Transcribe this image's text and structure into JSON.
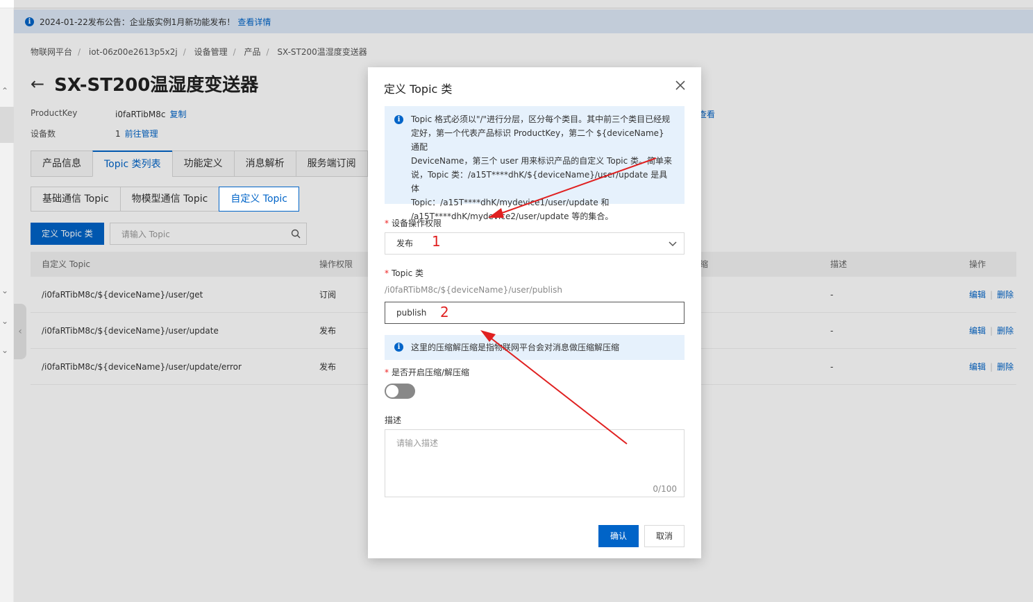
{
  "notice": {
    "text": "2024-01-22发布公告：企业版实例1月新功能发布！",
    "link": "查看详情"
  },
  "breadcrumb": [
    "物联网平台",
    "iot-06z00e2613p5x2j",
    "设备管理",
    "产品",
    "SX-ST200温湿度变送器"
  ],
  "page": {
    "title": "SX-ST200温湿度变送器",
    "productkey_label": "ProductKey",
    "productkey_value": "i0faRTibM8c",
    "copy_link": "复制",
    "devices_label": "设备数",
    "devices_value": "1",
    "manage_link": "前往管理",
    "right_link": "查看"
  },
  "tabs": [
    "产品信息",
    "Topic 类列表",
    "功能定义",
    "消息解析",
    "服务端订阅"
  ],
  "subtabs": [
    "基础通信 Topic",
    "物模型通信 Topic",
    "自定义 Topic"
  ],
  "toolbar": {
    "define_button": "定义 Topic 类",
    "search_placeholder": "请输入 Topic"
  },
  "table": {
    "headers": {
      "topic": "自定义 Topic",
      "permission": "操作权限",
      "compress": "压缩",
      "desc": "描述",
      "ops": "操作"
    },
    "rows": [
      {
        "topic": "/i0faRTibM8c/${deviceName}/user/get",
        "permission": "订阅",
        "desc": "-",
        "edit": "编辑",
        "delete": "删除"
      },
      {
        "topic": "/i0faRTibM8c/${deviceName}/user/update",
        "permission": "发布",
        "desc": "-",
        "edit": "编辑",
        "delete": "删除"
      },
      {
        "topic": "/i0faRTibM8c/${deviceName}/user/update/error",
        "permission": "发布",
        "desc": "-",
        "edit": "编辑",
        "delete": "删除"
      }
    ]
  },
  "modal": {
    "title": "定义 Topic 类",
    "info_lines": [
      "Topic 格式必须以\"/\"进行分层，区分每个类目。其中前三个类目已经规",
      "定好，第一个代表产品标识 ProductKey，第二个 ${deviceName} 通配",
      "DeviceName，第三个 user 用来标识产品的自定义 Topic 类。简单来",
      "说，Topic 类：/a15T****dhK/${deviceName}/user/update 是具体",
      "Topic：/a15T****dhK/mydevice1/user/update 和",
      "/a15T****dhK/mydevice2/user/update 等的集合。"
    ],
    "permission_label": "设备操作权限",
    "permission_value": "发布",
    "topic_label": "Topic 类",
    "topic_prefix": "/i0faRTibM8c/${deviceName}/user/publish",
    "topic_value": "publish",
    "compress_info": "这里的压缩解压缩是指物联网平台会对消息做压缩解压缩",
    "compress_label": "是否开启压缩/解压缩",
    "compress_enabled": false,
    "desc_label": "描述",
    "desc_placeholder": "请输入描述",
    "desc_count": "0/100",
    "ok_button": "确认",
    "cancel_button": "取消"
  },
  "annotations": {
    "one": "1",
    "two": "2"
  }
}
